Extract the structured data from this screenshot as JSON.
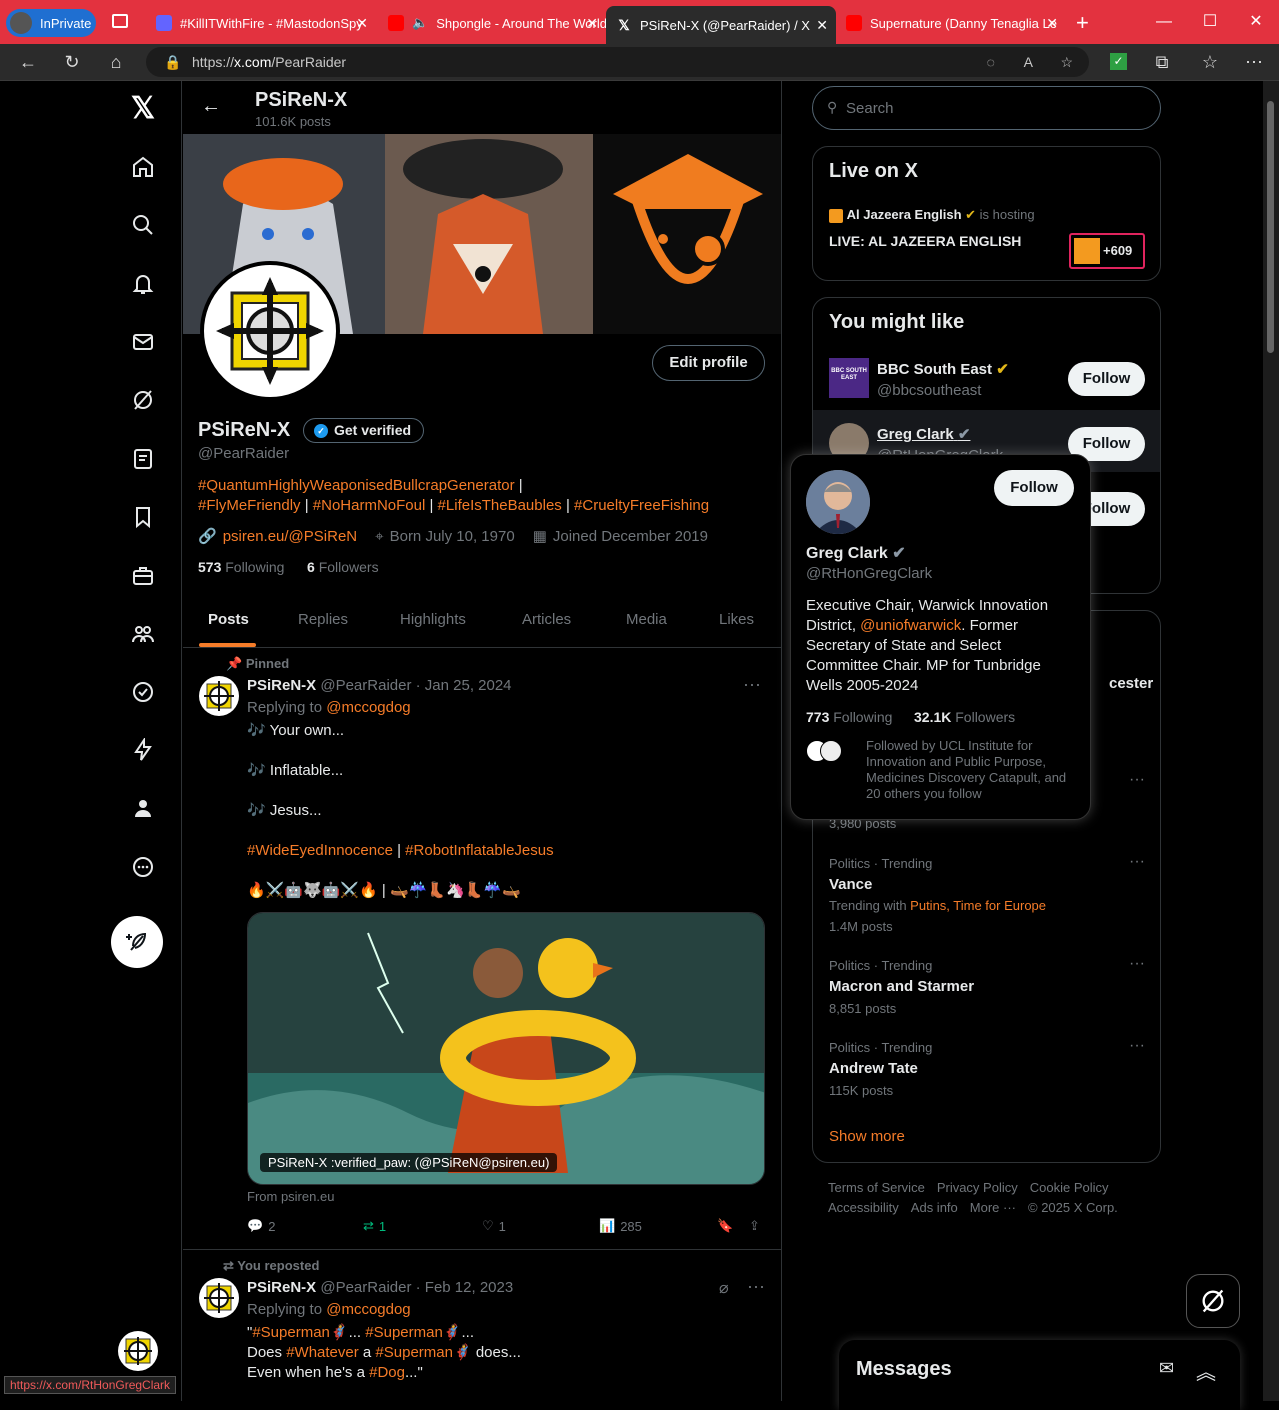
{
  "browser": {
    "inprivate": "InPrivate",
    "tabs": [
      {
        "title": "#KillITWithFire - #MastodonSpy",
        "color": "#6364ff"
      },
      {
        "title": "Shpongle - Around The World",
        "color": "#ff0000"
      },
      {
        "title": "PSiReN-X (@PearRaider) / X",
        "color": "#000000"
      },
      {
        "title": "Supernature (Danny Tenaglia Le",
        "color": "#ff0000"
      }
    ],
    "url_prefix": "https://",
    "url_domain": "x.com",
    "url_path": "/PearRaider",
    "status_url": "https://x.com/RtHonGregClark"
  },
  "profile": {
    "header_name": "PSiReN-X",
    "header_posts": "101.6K posts",
    "name": "PSiReN-X",
    "get_verified": "Get verified",
    "edit_profile": "Edit profile",
    "handle": "@PearRaider",
    "bio_line1_tag": "#QuantumHighlyWeaponisedBullcrapGenerator",
    "bio_line1_sep": " |",
    "bio_tag2": "#FlyMeFriendly",
    "bio_tag3": "#NoHarmNoFoul",
    "bio_tag4": "#LifeIsTheBaubles",
    "bio_tag5": "#CrueltyFreeFishing",
    "bio_sep": " | ",
    "link": "psiren.eu/@PSiReN",
    "born": "Born July 10, 1970",
    "joined": "Joined December 2019",
    "following_count": "573",
    "following_label": "Following",
    "followers_count": "6",
    "followers_label": "Followers"
  },
  "tabs": [
    "Posts",
    "Replies",
    "Highlights",
    "Articles",
    "Media",
    "Likes"
  ],
  "post1": {
    "pinned": "Pinned",
    "name": "PSiReN-X",
    "meta": "@PearRaider · Jan 25, 2024",
    "replying": "Replying to ",
    "reply_to": "@mccogdog",
    "line1": "🎶 Your own...",
    "line2": "🎶 Inflatable...",
    "line3": "🎶 Jesus...",
    "tag1": "#WideEyedInnocence",
    "sep": " | ",
    "tag2": "#RobotInflatableJesus",
    "emojis": "🔥⚔️🤖🐺🤖⚔️🔥 | 🛶☔👢🦄👢☔🛶",
    "image_caption": "PSiReN-X :verified_paw: (@PSiReN@psiren.eu)",
    "from": "From psiren.eu",
    "replies": "2",
    "reposts": "1",
    "likes": "1",
    "views": "285"
  },
  "post2": {
    "reposted": "You reposted",
    "name": "PSiReN-X",
    "meta": "@PearRaider · Feb 12, 2023",
    "replying": "Replying to ",
    "reply_to": "@mccogdog",
    "l1a": "\"",
    "l1t1": "#Superman",
    "l1b": "🦸... ",
    "l1t2": "#Superman",
    "l1c": "🦸...",
    "l2a": "Does ",
    "l2t1": "#Whatever",
    "l2b": " a ",
    "l2t2": "#Superman",
    "l2c": "🦸 does...",
    "l3a": "Even when he's a ",
    "l3t": "#Dog",
    "l3b": "...\""
  },
  "right": {
    "search_placeholder": "Search",
    "live_title": "Live on X",
    "live_host": "Al Jazeera English",
    "live_hosting": " is hosting",
    "live_event": "LIVE: AL JAZEERA ENGLISH",
    "live_count": "+609",
    "wtf_title": "You might like",
    "suggestions": [
      {
        "name": "BBC South East",
        "handle": "@bbcsoutheast",
        "follow": "Follow",
        "avatar": "BBC SOUTH EAST"
      },
      {
        "name": "Greg Clark",
        "handle": "@RtHonGregClark",
        "follow": "Follow"
      },
      {
        "follow": "Follow"
      }
    ],
    "trend_partial": "cester",
    "trend_partial_posts": "3,980 posts",
    "trends": [
      {
        "cat": "Politics · Trending",
        "name": "Vance",
        "with_label": "Trending with ",
        "with": "Putins, Time for Europe",
        "posts": "1.4M posts"
      },
      {
        "cat": "Politics · Trending",
        "name": "Macron and Starmer",
        "posts": "8,851 posts"
      },
      {
        "cat": "Politics · Trending",
        "name": "Andrew Tate",
        "posts": "115K posts"
      }
    ],
    "show_more": "Show more",
    "footer1": [
      "Terms of Service",
      "Privacy Policy",
      "Cookie Policy"
    ],
    "footer2": [
      "Accessibility",
      "Ads info",
      "More ···",
      "© 2025 X Corp."
    ],
    "messages": "Messages"
  },
  "hovercard": {
    "follow": "Follow",
    "name": "Greg Clark",
    "handle": "@RtHonGregClark",
    "bio_a": "Executive Chair, Warwick Innovation District, ",
    "bio_link": "@uniofwarwick",
    "bio_b": ". Former Secretary of State and Select Committee Chair. MP for Tunbridge Wells 2005-2024",
    "following_count": "773",
    "following_label": "Following",
    "followers_count": "32.1K",
    "followers_label": "Followers",
    "followed_by": "Followed by UCL Institute for Innovation and Public Purpose, Medicines Discovery Catapult, and 20 others you follow"
  },
  "colors": {
    "accent": "#f57c29",
    "verified_gold": "#e2b719",
    "verified_blue": "#1d9bf0",
    "edge_red": "#e3323f"
  }
}
